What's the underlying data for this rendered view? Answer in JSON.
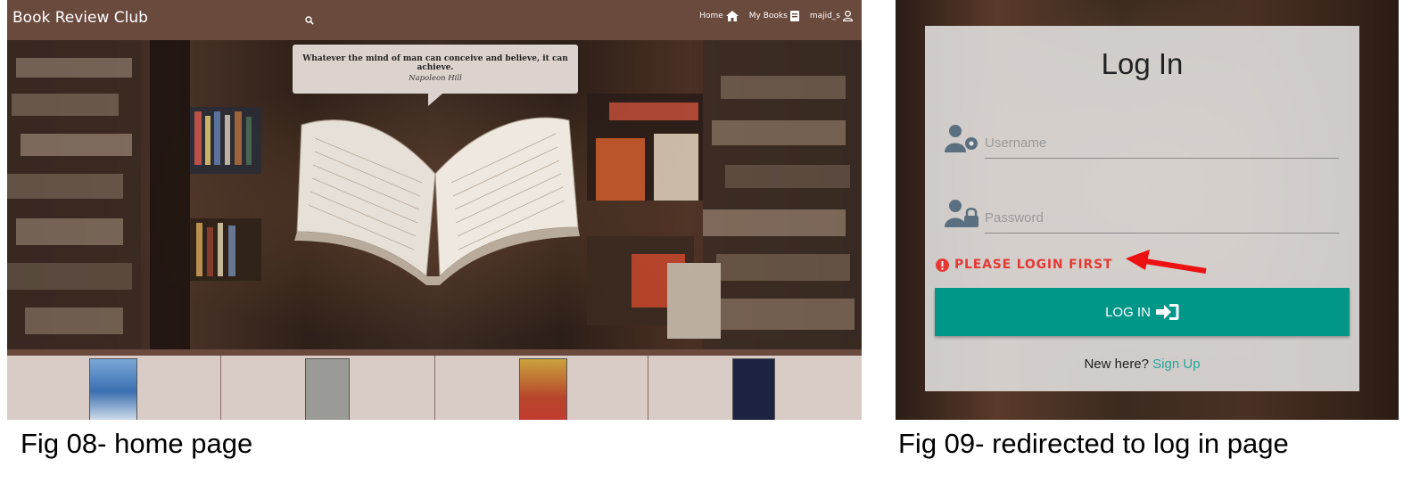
{
  "home": {
    "brand": "Book Review Club",
    "nav": {
      "home": "Home",
      "my_books": "My Books",
      "user": "majid_s"
    },
    "quote": {
      "text": "Whatever the mind of man can conceive and believe, it can achieve.",
      "author": "Napoleon Hill"
    },
    "books": [
      {
        "cover_color": "#3a6fb0"
      },
      {
        "cover_color": "#9a9a96"
      },
      {
        "cover_color": "#b8452c"
      },
      {
        "cover_color": "#1c2340"
      }
    ],
    "caption": "Fig 08- home page"
  },
  "login": {
    "title": "Log In",
    "username_placeholder": "Username",
    "password_placeholder": "Password",
    "error": "PLEASE LOGIN FIRST",
    "button": "LOG IN",
    "new_here": "New here?",
    "sign_up": "Sign Up",
    "caption": "Fig 09- redirected to log in page"
  },
  "colors": {
    "nav": "#6b4a3e",
    "accent": "#009688",
    "error": "#e53935",
    "arrow": "#ee1111"
  }
}
